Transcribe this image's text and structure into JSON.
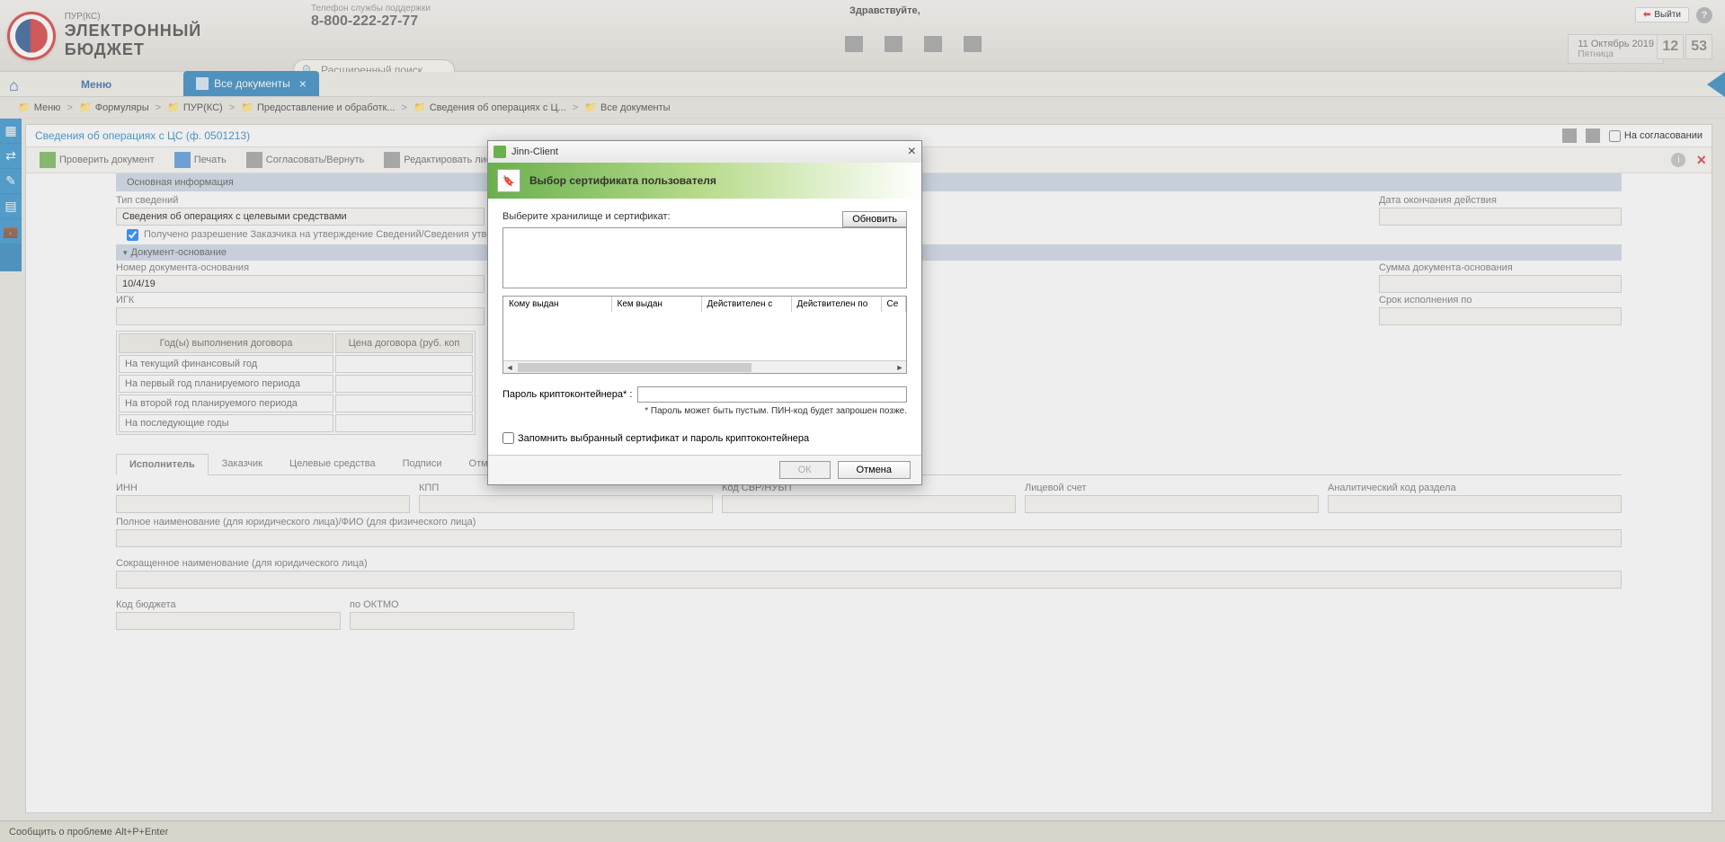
{
  "header": {
    "logo_small": "ПУР(КС)",
    "logo_big": "ЭЛЕКТРОННЫЙ БЮДЖЕТ",
    "support_label": "Телефон службы поддержки",
    "support_phone": "8-800-222-27-77",
    "search_placeholder": "Расширенный поиск",
    "greeting": "Здравствуйте,",
    "logout": "Выйти",
    "help": "?",
    "date": "11 Октябрь 2019",
    "day": "Пятница",
    "time_hh": "12",
    "time_mm": "53"
  },
  "menu": {
    "home": "⌂",
    "menu_label": "Меню",
    "active_tab": "Все документы",
    "tab_close": "×"
  },
  "breadcrumb": [
    "Меню",
    "Формуляры",
    "ПУР(КС)",
    "Предоставление и обработк...",
    "Сведения об операциях с Ц...",
    "Все документы"
  ],
  "panel": {
    "title": "Сведения об операциях с ЦС (ф. 0501213)",
    "on_agree": "На согласовании"
  },
  "toolbar": {
    "check": "Проверить документ",
    "print": "Печать",
    "approve": "Согласовать/Вернуть",
    "edit": "Редактировать лист согласов"
  },
  "form": {
    "section_main": "Основная информация",
    "type_label": "Тип сведений",
    "type_value": "Сведения об операциях с целевыми средствами",
    "end_date_label": "Дата окончания действия",
    "permission_text": "Получено разрешение Заказчика на утверждение Сведений/Сведения утверждены носителе",
    "doc_basis": "Документ-основание",
    "doc_num_label": "Номер документа-основания",
    "doc_num_value": "10/4/19",
    "sum_label": "Сумма документа-основания",
    "igk_label": "ИГК",
    "deadline_label": "Срок исполнения по",
    "years_col": "Год(ы) выполнения договора",
    "price_col": "Цена договора (руб. коп",
    "year_rows": [
      "На текущий финансовый год",
      "На первый год планируемого периода",
      "На второй год планируемого периода",
      "На последующие годы"
    ],
    "tabs": [
      "Исполнитель",
      "Заказчик",
      "Целевые средства",
      "Подписи",
      "Отметки ЦС обслуж"
    ],
    "inn": "ИНН",
    "kpp": "КПП",
    "svr": "Код СВР/НУБП",
    "account": "Лицевой счет",
    "analytical": "Аналитический код раздела",
    "fullname": "Полное наименование (для юридического лица)/ФИО (для физического лица)",
    "shortname": "Сокращенное наименование (для юридического лица)",
    "budget_code": "Код бюджета",
    "oktmo": "по ОКТМО"
  },
  "modal": {
    "app_title": "Jinn-Client",
    "header": "Выбор сертификата пользователя",
    "select_label": "Выберите хранилище и сертификат:",
    "refresh": "Обновить",
    "cols": [
      "Кому выдан",
      "Кем выдан",
      "Действителен с",
      "Действителен по",
      "Се"
    ],
    "pass_label": "Пароль криптоконтейнера* :",
    "pass_hint": "* Пароль может быть пустым. ПИН-код будет запрошен позже.",
    "remember": "Запомнить выбранный сертификат и пароль криптоконтейнера",
    "ok": "ОК",
    "cancel": "Отмена"
  },
  "footer": {
    "report": "Сообщить о проблеме Alt+P+Enter"
  }
}
